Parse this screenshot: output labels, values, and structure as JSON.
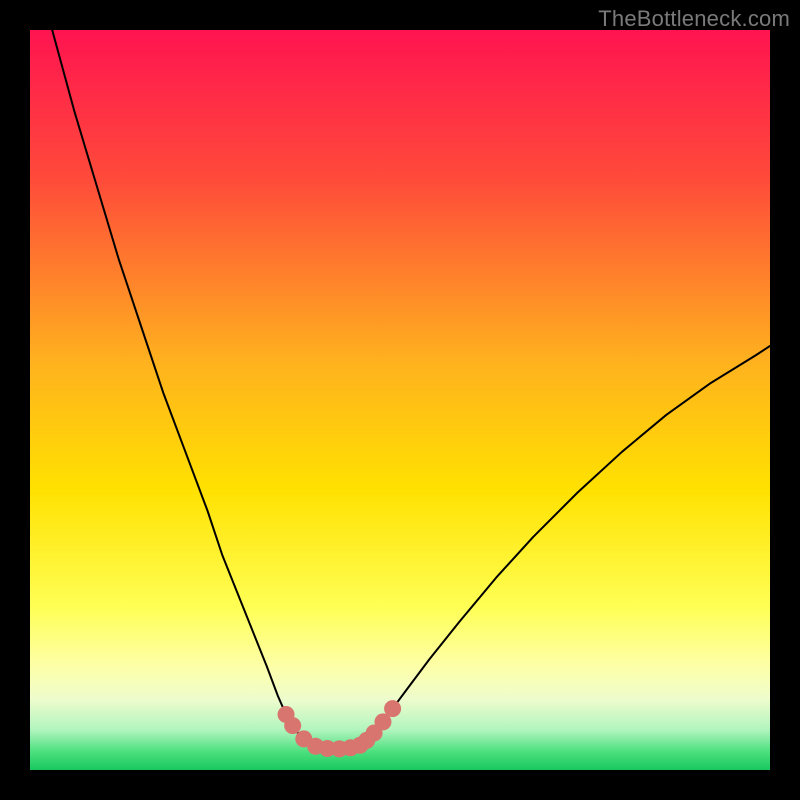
{
  "watermark": "TheBottleneck.com",
  "chart_data": {
    "type": "line",
    "title": "",
    "xlabel": "",
    "ylabel": "",
    "xlim": [
      0,
      100
    ],
    "ylim": [
      0,
      100
    ],
    "grid": false,
    "legend": false,
    "annotations": [],
    "background_gradient_stops": [
      {
        "offset": 0.0,
        "color": "#ff1450"
      },
      {
        "offset": 0.2,
        "color": "#ff4a3a"
      },
      {
        "offset": 0.45,
        "color": "#ffb21e"
      },
      {
        "offset": 0.62,
        "color": "#ffe100"
      },
      {
        "offset": 0.78,
        "color": "#ffff55"
      },
      {
        "offset": 0.86,
        "color": "#fdffa8"
      },
      {
        "offset": 0.905,
        "color": "#eefccd"
      },
      {
        "offset": 0.945,
        "color": "#b3f5bf"
      },
      {
        "offset": 0.975,
        "color": "#4de07f"
      },
      {
        "offset": 1.0,
        "color": "#18c85e"
      }
    ],
    "series": [
      {
        "name": "left-branch",
        "type": "line",
        "x": [
          3,
          6,
          9,
          12,
          15,
          18,
          21,
          24,
          26,
          28,
          30,
          32,
          33.5,
          34.6,
          35.5,
          36.2,
          37,
          37.8,
          38.6,
          39.5
        ],
        "y": [
          100,
          89,
          79,
          69,
          60,
          51,
          43,
          35,
          29,
          24,
          19,
          14,
          10,
          7.5,
          6,
          5,
          4.2,
          3.6,
          3.2,
          3
        ]
      },
      {
        "name": "valley-floor",
        "type": "line",
        "x": [
          39.5,
          40.2,
          41,
          41.8,
          42.6,
          43.3,
          44,
          44.6
        ],
        "y": [
          3,
          2.9,
          2.85,
          2.85,
          2.9,
          3.0,
          3.15,
          3.35
        ]
      },
      {
        "name": "right-branch",
        "type": "line",
        "x": [
          44.6,
          45.5,
          46.5,
          47.7,
          49,
          51,
          54,
          58,
          63,
          68,
          74,
          80,
          86,
          92,
          98,
          100
        ],
        "y": [
          3.35,
          4.0,
          5.0,
          6.5,
          8.3,
          11,
          15,
          20,
          26,
          31.5,
          37.5,
          43,
          48,
          52.3,
          56,
          57.3
        ]
      }
    ],
    "markers": {
      "name": "valley-beads",
      "color": "#d9756f",
      "radius_pct": 1.15,
      "points": [
        {
          "x": 34.6,
          "y": 7.5
        },
        {
          "x": 35.5,
          "y": 6.0
        },
        {
          "x": 37.0,
          "y": 4.2
        },
        {
          "x": 38.6,
          "y": 3.2
        },
        {
          "x": 40.2,
          "y": 2.9
        },
        {
          "x": 41.8,
          "y": 2.85
        },
        {
          "x": 43.3,
          "y": 3.0
        },
        {
          "x": 44.6,
          "y": 3.35
        },
        {
          "x": 45.5,
          "y": 4.0
        },
        {
          "x": 46.5,
          "y": 5.0
        },
        {
          "x": 47.7,
          "y": 6.5
        },
        {
          "x": 49.0,
          "y": 8.3
        }
      ]
    }
  }
}
